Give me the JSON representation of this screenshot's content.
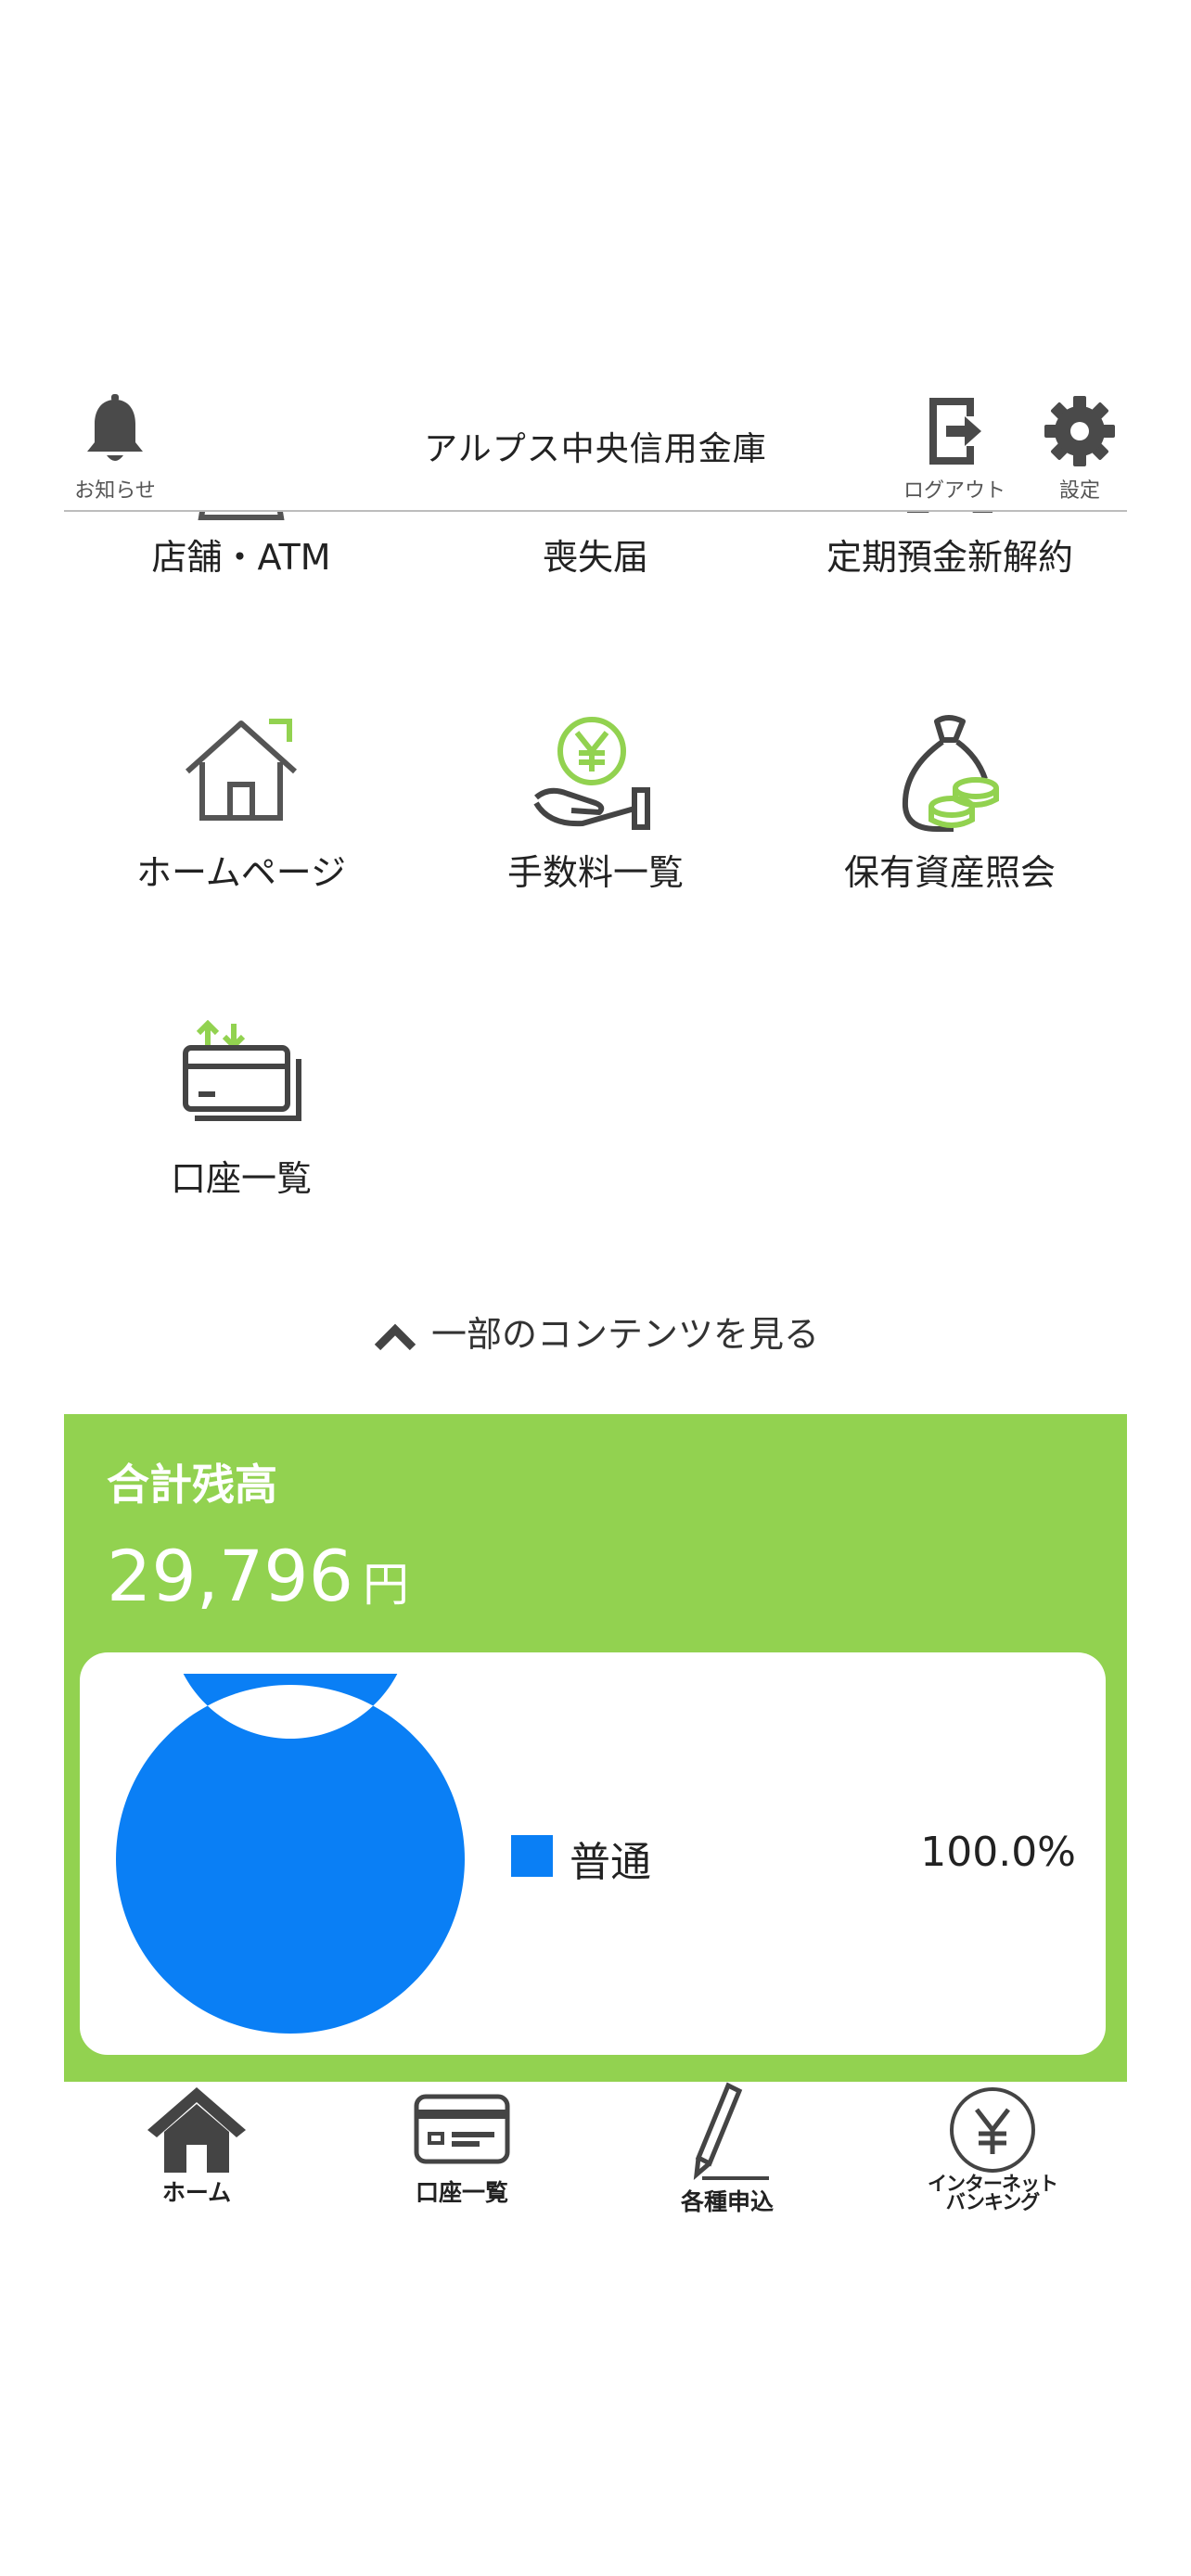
{
  "header": {
    "title": "アルプス中央信用金庫",
    "notice_label": "お知らせ",
    "logout_label": "ログアウト",
    "settings_label": "設定"
  },
  "menu": {
    "items": [
      {
        "label": "店舗・ATM",
        "icon": "store-atm-icon"
      },
      {
        "label": "喪失届",
        "icon": "loss-report-icon"
      },
      {
        "label": "定期預金新解約",
        "icon": "piggy-bank-icon"
      },
      {
        "label": "ホームページ",
        "icon": "house-icon"
      },
      {
        "label": "手数料一覧",
        "icon": "yen-hand-icon"
      },
      {
        "label": "保有資産照会",
        "icon": "money-bag-icon"
      },
      {
        "label": "口座一覧",
        "icon": "card-transfer-icon"
      }
    ],
    "toggle_label": "一部のコンテンツを見る"
  },
  "balance": {
    "title": "合計残高",
    "amount": "29,796",
    "unit": "円",
    "legend": {
      "name": "普通",
      "percent": "100.0%"
    }
  },
  "chart_data": {
    "type": "pie",
    "categories": [
      "普通"
    ],
    "values": [
      100.0
    ],
    "colors": [
      "#0a7ff5"
    ]
  },
  "bottom_nav": {
    "items": [
      {
        "label": "ホーム",
        "icon": "home-icon"
      },
      {
        "label": "口座一覧",
        "icon": "account-card-icon"
      },
      {
        "label": "各種申込",
        "icon": "pencil-icon"
      },
      {
        "label": "インターネットバンキング",
        "line1": "インターネット",
        "line2": "バンキング",
        "icon": "yen-circle-icon"
      }
    ]
  },
  "colors": {
    "accent_green": "#92d250",
    "chart_blue": "#0a7ff5",
    "icon_gray": "#555555"
  }
}
